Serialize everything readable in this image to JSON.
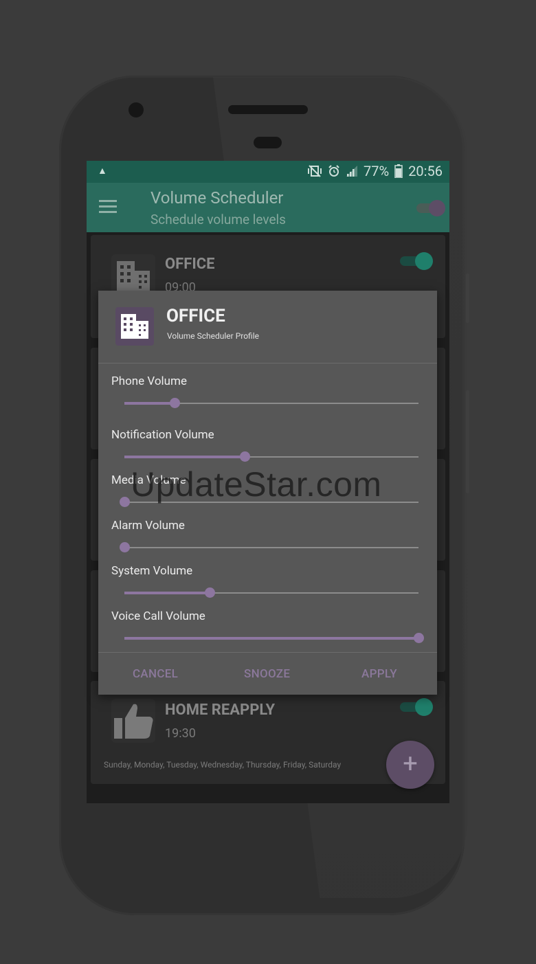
{
  "statusbar": {
    "battery": "77%",
    "time": "20:56"
  },
  "appbar": {
    "title": "Volume Scheduler",
    "subtitle": "Schedule volume levels"
  },
  "cards": [
    {
      "name": "OFFICE",
      "time": "09:00",
      "days": ""
    },
    {
      "name": "HOME REAPPLY",
      "time": "19:30",
      "days": "Sunday, Monday, Tuesday, Wednesday, Thursday, Friday, Saturday"
    }
  ],
  "dialog": {
    "title": "OFFICE",
    "subtitle": "Volume Scheduler Profile",
    "sliders": [
      {
        "label": "Phone Volume",
        "value": 0.17
      },
      {
        "label": "Notification Volume",
        "value": 0.41
      },
      {
        "label": "Media Volume",
        "value": 0.0
      },
      {
        "label": "Alarm Volume",
        "value": 0.0
      },
      {
        "label": "System Volume",
        "value": 0.29
      },
      {
        "label": "Voice Call Volume",
        "value": 1.0
      }
    ],
    "buttons": {
      "cancel": "CANCEL",
      "snooze": "SNOOZE",
      "apply": "APPLY"
    }
  },
  "watermark": "UpdateStar.com",
  "colors": {
    "accent": "#8d76a0",
    "primary": "#2a6b5d",
    "switch_on": "#1f7f6b"
  },
  "icons": {
    "building": "building-icon",
    "thumbs_up": "thumbs-up-icon",
    "menu": "menu-icon",
    "add": "plus-icon"
  }
}
